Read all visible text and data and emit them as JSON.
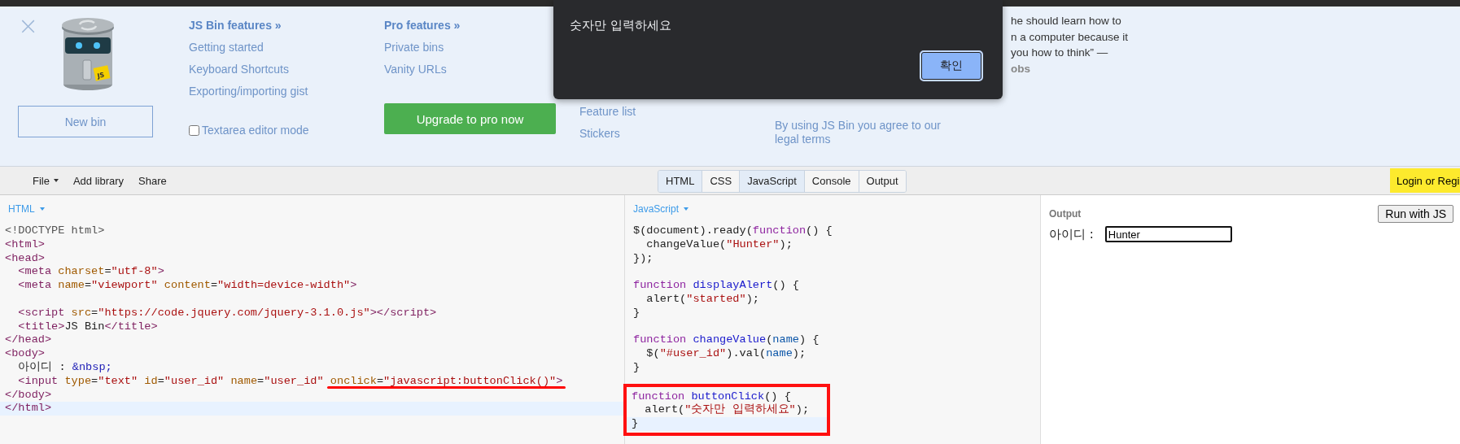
{
  "banner": {
    "close_button": {
      "label": "×"
    },
    "logo_badge": "JS",
    "new_bin_button": "New bin",
    "features": {
      "title": "JS Bin features »",
      "links": [
        "Getting started",
        "Keyboard Shortcuts",
        "Exporting/importing gist"
      ]
    },
    "textarea_mode": {
      "label": "Textarea editor mode",
      "checked": false
    },
    "pro": {
      "title": "Pro features »",
      "links": [
        "Private bins",
        "Vanity URLs"
      ],
      "upgrade_button": "Upgrade to pro now"
    },
    "more_links": [
      "Feature list",
      "Stickers"
    ],
    "legal": "By using JS Bin you agree to our legal terms",
    "quote_lines": [
      "he should learn how to",
      "n a computer because it",
      "you how to think” —",
      "obs"
    ]
  },
  "alert_dialog": {
    "message": "숫자만 입력하세요",
    "ok_button": "확인"
  },
  "toolbar": {
    "menu": [
      {
        "label": "File",
        "dropdown": true
      },
      {
        "label": "Add library",
        "dropdown": false
      },
      {
        "label": "Share",
        "dropdown": false
      }
    ],
    "tabs": [
      {
        "label": "HTML",
        "selected": true
      },
      {
        "label": "CSS",
        "selected": false
      },
      {
        "label": "JavaScript",
        "selected": true
      },
      {
        "label": "Console",
        "selected": false
      },
      {
        "label": "Output",
        "selected": false
      }
    ],
    "login_button": "Login or Regi"
  },
  "html_editor": {
    "label": "HTML",
    "blocks": [
      {
        "lines": [
          {
            "active": false,
            "tokens": [
              {
                "kind": "meta",
                "text": "<!DOCTYPE html>"
              }
            ]
          },
          {
            "active": false,
            "tokens": [
              {
                "kind": "tag",
                "text": "<html>"
              }
            ]
          },
          {
            "active": false,
            "tokens": [
              {
                "kind": "tag",
                "text": "<head>"
              }
            ]
          },
          {
            "active": false,
            "tokens": [
              {
                "kind": "tag",
                "text": "  <meta"
              },
              {
                "kind": "attr",
                "text": " charset"
              },
              {
                "kind": "plain",
                "text": "="
              },
              {
                "kind": "string",
                "text": "\"utf-8\""
              },
              {
                "kind": "tag",
                "text": ">"
              }
            ]
          },
          {
            "active": false,
            "tokens": [
              {
                "kind": "tag",
                "text": "  <meta"
              },
              {
                "kind": "attr",
                "text": " name"
              },
              {
                "kind": "plain",
                "text": "="
              },
              {
                "kind": "string",
                "text": "\"viewport\""
              },
              {
                "kind": "attr",
                "text": " content"
              },
              {
                "kind": "plain",
                "text": "="
              },
              {
                "kind": "string",
                "text": "\"width=device-width\""
              },
              {
                "kind": "tag",
                "text": ">"
              }
            ]
          }
        ]
      },
      {
        "lines": [
          {
            "active": false,
            "tokens": [
              {
                "kind": "tag",
                "text": "  <script"
              },
              {
                "kind": "attr",
                "text": " src"
              },
              {
                "kind": "plain",
                "text": "="
              },
              {
                "kind": "string",
                "text": "\"https://code.jquery.com/jquery-3.1.0.js\""
              },
              {
                "kind": "tag",
                "text": "></script>"
              }
            ]
          },
          {
            "active": false,
            "tokens": [
              {
                "kind": "tag",
                "text": "  <title>"
              },
              {
                "kind": "plain",
                "text": "JS Bin"
              },
              {
                "kind": "tag",
                "text": "</title>"
              }
            ]
          },
          {
            "active": false,
            "tokens": [
              {
                "kind": "tag",
                "text": "</head>"
              }
            ]
          },
          {
            "active": false,
            "tokens": [
              {
                "kind": "tag",
                "text": "<body>"
              }
            ]
          },
          {
            "active": false,
            "tokens": [
              {
                "kind": "plain",
                "text": "  아이디 : "
              },
              {
                "kind": "entity",
                "text": "&nbsp;"
              }
            ]
          },
          {
            "active": false,
            "tokens": [
              {
                "kind": "tag",
                "text": "  <input"
              },
              {
                "kind": "attr",
                "text": " type"
              },
              {
                "kind": "plain",
                "text": "="
              },
              {
                "kind": "string",
                "text": "\"text\""
              },
              {
                "kind": "attr",
                "text": " id"
              },
              {
                "kind": "plain",
                "text": "="
              },
              {
                "kind": "string",
                "text": "\"user_id\""
              },
              {
                "kind": "attr",
                "text": " name"
              },
              {
                "kind": "plain",
                "text": "="
              },
              {
                "kind": "string",
                "text": "\"user_id\" "
              },
              {
                "kind": "attr",
                "text": "onclick",
                "underlined": true
              },
              {
                "kind": "plain",
                "text": "=",
                "underlined": true
              },
              {
                "kind": "string",
                "text": "\"javascript:buttonClick()\"",
                "underlined": true
              },
              {
                "kind": "tag",
                "text": ">",
                "underlined": true
              }
            ]
          },
          {
            "active": false,
            "tokens": [
              {
                "kind": "tag",
                "text": "</body>"
              }
            ]
          },
          {
            "active": true,
            "tokens": [
              {
                "kind": "tag",
                "text": "</html>"
              }
            ]
          }
        ]
      }
    ]
  },
  "js_editor": {
    "label": "JavaScript",
    "blocks": [
      {
        "boxed": false,
        "lines": [
          {
            "active": false,
            "tokens": [
              {
                "kind": "plain",
                "text": "$(document).ready("
              },
              {
                "kind": "keyword",
                "text": "function"
              },
              {
                "kind": "plain",
                "text": "() {"
              }
            ]
          },
          {
            "active": false,
            "tokens": [
              {
                "kind": "plain",
                "text": "  changeValue("
              },
              {
                "kind": "string",
                "text": "\"Hunter\""
              },
              {
                "kind": "plain",
                "text": ");"
              }
            ]
          },
          {
            "active": false,
            "tokens": [
              {
                "kind": "plain",
                "text": "});"
              }
            ]
          }
        ]
      },
      {
        "boxed": false,
        "lines": [
          {
            "active": false,
            "tokens": [
              {
                "kind": "keyword",
                "text": "function"
              },
              {
                "kind": "def",
                "text": " displayAlert"
              },
              {
                "kind": "plain",
                "text": "() {"
              }
            ]
          },
          {
            "active": false,
            "tokens": [
              {
                "kind": "plain",
                "text": "  alert("
              },
              {
                "kind": "string",
                "text": "\"started\""
              },
              {
                "kind": "plain",
                "text": ");"
              }
            ]
          },
          {
            "active": false,
            "tokens": [
              {
                "kind": "plain",
                "text": "}"
              }
            ]
          }
        ]
      },
      {
        "boxed": false,
        "lines": [
          {
            "active": false,
            "tokens": [
              {
                "kind": "keyword",
                "text": "function"
              },
              {
                "kind": "def",
                "text": " changeValue"
              },
              {
                "kind": "plain",
                "text": "("
              },
              {
                "kind": "variable",
                "text": "name"
              },
              {
                "kind": "plain",
                "text": ") {"
              }
            ]
          },
          {
            "active": false,
            "tokens": [
              {
                "kind": "plain",
                "text": "  $("
              },
              {
                "kind": "string",
                "text": "\"#user_id\""
              },
              {
                "kind": "plain",
                "text": ").val("
              },
              {
                "kind": "variable",
                "text": "name"
              },
              {
                "kind": "plain",
                "text": ");"
              }
            ]
          },
          {
            "active": false,
            "tokens": [
              {
                "kind": "plain",
                "text": "}"
              }
            ]
          }
        ]
      },
      {
        "boxed": true,
        "lines": [
          {
            "active": false,
            "tokens": [
              {
                "kind": "keyword",
                "text": "function"
              },
              {
                "kind": "def",
                "text": " buttonClick"
              },
              {
                "kind": "plain",
                "text": "() {"
              }
            ]
          },
          {
            "active": false,
            "tokens": [
              {
                "kind": "plain",
                "text": "  alert("
              },
              {
                "kind": "string",
                "text": "\"숫자만 입력하세요\""
              },
              {
                "kind": "plain",
                "text": ");"
              }
            ]
          },
          {
            "active": true,
            "tokens": [
              {
                "kind": "plain",
                "text": "}"
              }
            ]
          }
        ]
      }
    ]
  },
  "output": {
    "label": "Output",
    "run_button": "Run with JS",
    "field_label": "아이디 :",
    "field_value": "Hunter"
  }
}
